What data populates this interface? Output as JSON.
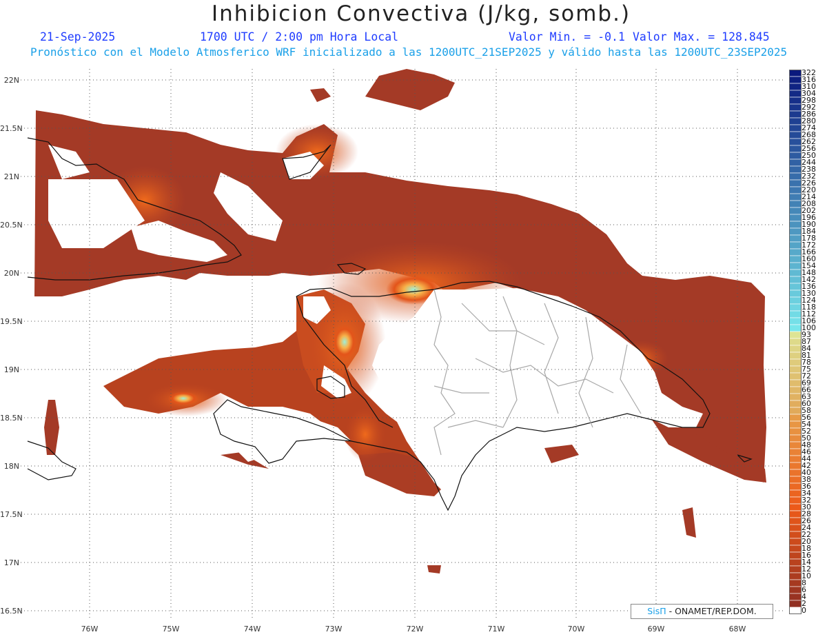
{
  "title": "Inhibicion Convectiva (J/kg, somb.)",
  "header": {
    "date": "21-Sep-2025",
    "time": "1700 UTC / 2:00 pm Hora Local",
    "valmin_label": "Valor Min. = -0.1",
    "valmax_label": "Valor Max. = 128.845",
    "subtitle": "Pronóstico con el Modelo Atmosferico WRF inicializado a las 1200UTC_21SEP2025 y válido hasta las  1200UTC_23SEP2025"
  },
  "axes": {
    "lat_labels": [
      "22N",
      "21.5N",
      "21N",
      "20.5N",
      "20N",
      "19.5N",
      "19N",
      "18.5N",
      "18N",
      "17.5N",
      "17N",
      "16.5N"
    ],
    "lon_labels": [
      "76W",
      "75W",
      "74W",
      "73W",
      "72W",
      "71W",
      "70W",
      "69W",
      "68W"
    ]
  },
  "legend": {
    "labels": [
      "322",
      "316",
      "310",
      "304",
      "298",
      "292",
      "286",
      "280",
      "274",
      "268",
      "262",
      "256",
      "250",
      "244",
      "238",
      "232",
      "226",
      "220",
      "214",
      "208",
      "202",
      "196",
      "190",
      "184",
      "178",
      "172",
      "166",
      "160",
      "154",
      "148",
      "142",
      "136",
      "130",
      "124",
      "118",
      "112",
      "106",
      "100",
      "93",
      "87",
      "84",
      "81",
      "78",
      "75",
      "72",
      "69",
      "66",
      "63",
      "60",
      "58",
      "56",
      "54",
      "52",
      "50",
      "48",
      "46",
      "44",
      "42",
      "40",
      "38",
      "36",
      "34",
      "32",
      "30",
      "28",
      "26",
      "24",
      "22",
      "20",
      "18",
      "16",
      "14",
      "12",
      "10",
      "8",
      "6",
      "4",
      "2",
      "0"
    ]
  },
  "credit": {
    "brand": "SisΠ",
    "text": " - ONAMET/REP.DOM."
  },
  "colors": {
    "low": "#9b3a2a",
    "mid": "#f26a1b",
    "high_cyan": "#7fe8d4",
    "dark_blue": "#0c1a7a"
  }
}
